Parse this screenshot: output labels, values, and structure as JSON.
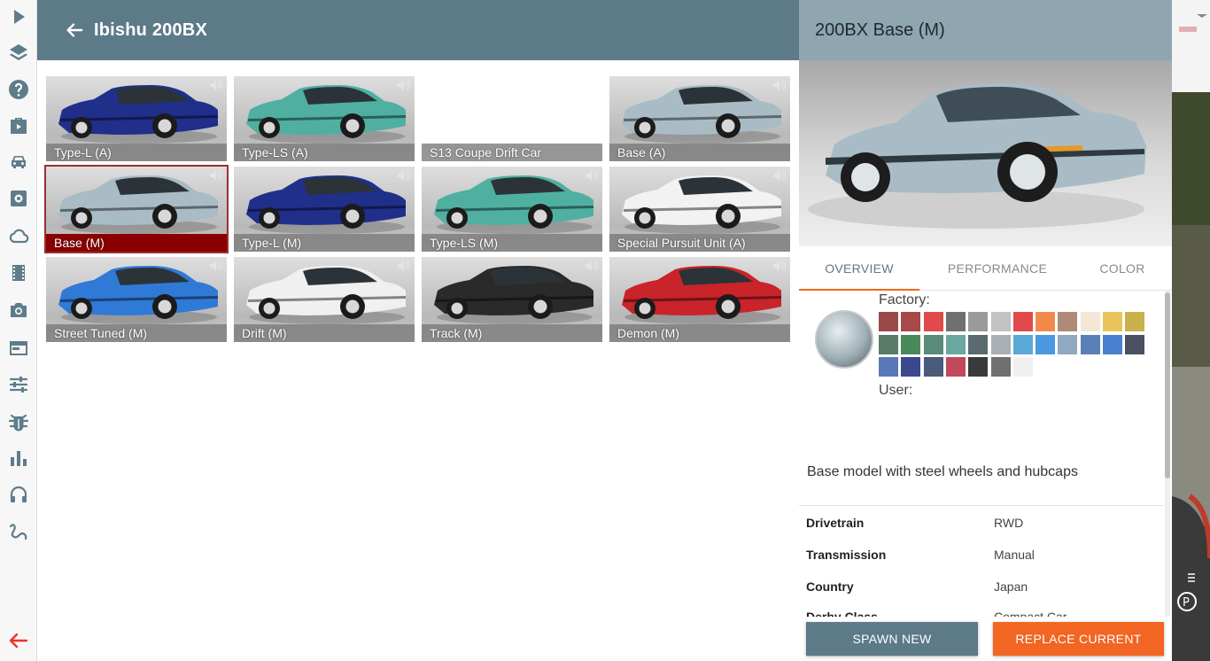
{
  "header": {
    "title": "Ibishu 200BX"
  },
  "configs": [
    {
      "label": "Type-L (A)",
      "color": "#1f2f8a",
      "selected": false
    },
    {
      "label": "Type-LS (A)",
      "color": "#4fb0a2",
      "selected": false
    },
    {
      "label": "S13 Coupe Drift Car",
      "color": "",
      "selected": false
    },
    {
      "label": "Base (A)",
      "color": "#a9bcc6",
      "selected": false
    },
    {
      "label": "Base (M)",
      "color": "#a9bcc6",
      "selected": true
    },
    {
      "label": "Type-L (M)",
      "color": "#1f2f8a",
      "selected": false
    },
    {
      "label": "Type-LS (M)",
      "color": "#4fb0a2",
      "selected": false
    },
    {
      "label": "Special Pursuit Unit (A)",
      "color": "#f2f2f2",
      "selected": false
    },
    {
      "label": "Street Tuned (M)",
      "color": "#2f7ad6",
      "selected": false
    },
    {
      "label": "Drift (M)",
      "color": "#f0f0f0",
      "selected": false
    },
    {
      "label": "Track (M)",
      "color": "#2a2a2a",
      "selected": false
    },
    {
      "label": "Demon (M)",
      "color": "#c8242a",
      "selected": false
    }
  ],
  "detail": {
    "title": "200BX Base (M)",
    "tabs": [
      "OVERVIEW",
      "PERFORMANCE",
      "COLOR"
    ],
    "active_tab": "OVERVIEW",
    "factory_label": "Factory:",
    "user_label": "User:",
    "factory_colors": [
      "#9a4848",
      "#a84848",
      "#e04a4a",
      "#707070",
      "#9a9a9a",
      "#c2c2c2",
      "#e04a4a",
      "#f08a4a",
      "#b08a78",
      "#f4e6d6",
      "#e8c45a",
      "#c8b04a",
      "#5a7a6a",
      "#4a8a5a",
      "#5a8a7a",
      "#6aa8a0",
      "#5a6a70",
      "#aab0b4",
      "#5aa8d8",
      "#4a98e0",
      "#90a8c0",
      "#5a80b8",
      "#4a80d0",
      "#4a5060",
      "#5a78b8",
      "#3a4890",
      "#4a5a7a",
      "#c04a5a",
      "#3a3a3a",
      "#707070",
      "#f0f0f0"
    ],
    "description": "Base model with steel wheels and hubcaps",
    "specs": [
      {
        "key": "Drivetrain",
        "value": "RWD"
      },
      {
        "key": "Transmission",
        "value": "Manual"
      },
      {
        "key": "Country",
        "value": "Japan"
      },
      {
        "key": "Derby Class",
        "value": "Compact Car"
      }
    ],
    "spawn_label": "SPAWN NEW",
    "replace_label": "REPLACE CURRENT"
  },
  "icons": [
    "play-icon",
    "layers-icon",
    "help-icon",
    "briefcase-icon",
    "car-icon",
    "gear-icon",
    "cloud-icon",
    "film-icon",
    "camera-icon",
    "window-icon",
    "sliders-icon",
    "bug-icon",
    "chart-icon",
    "headphones-icon",
    "path-icon",
    "exit-arrow-icon"
  ]
}
